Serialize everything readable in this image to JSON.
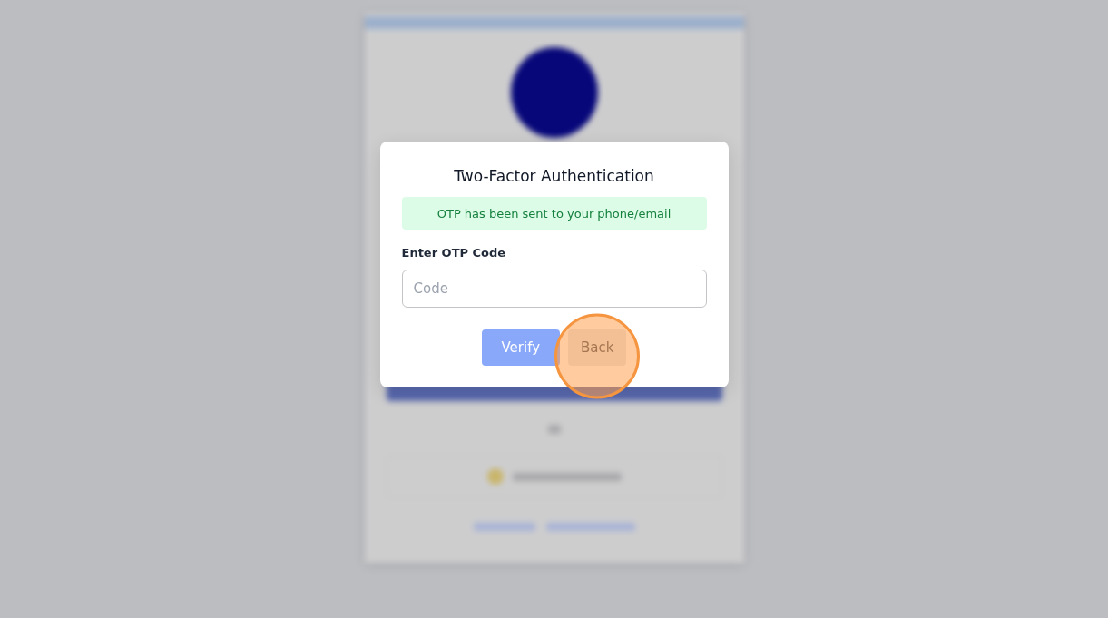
{
  "dialog": {
    "title": "Two-Factor Authentication",
    "alert": {
      "kind": "success",
      "text": "OTP has been sent to your phone/email"
    },
    "field": {
      "label": "Enter OTP Code",
      "placeholder": "Code"
    },
    "buttons": [
      {
        "label": "Verify",
        "kind": "primary",
        "disabled": true,
        "highlighted": false
      },
      {
        "label": "Back",
        "kind": "secondary",
        "disabled": false,
        "highlighted": true
      }
    ]
  }
}
